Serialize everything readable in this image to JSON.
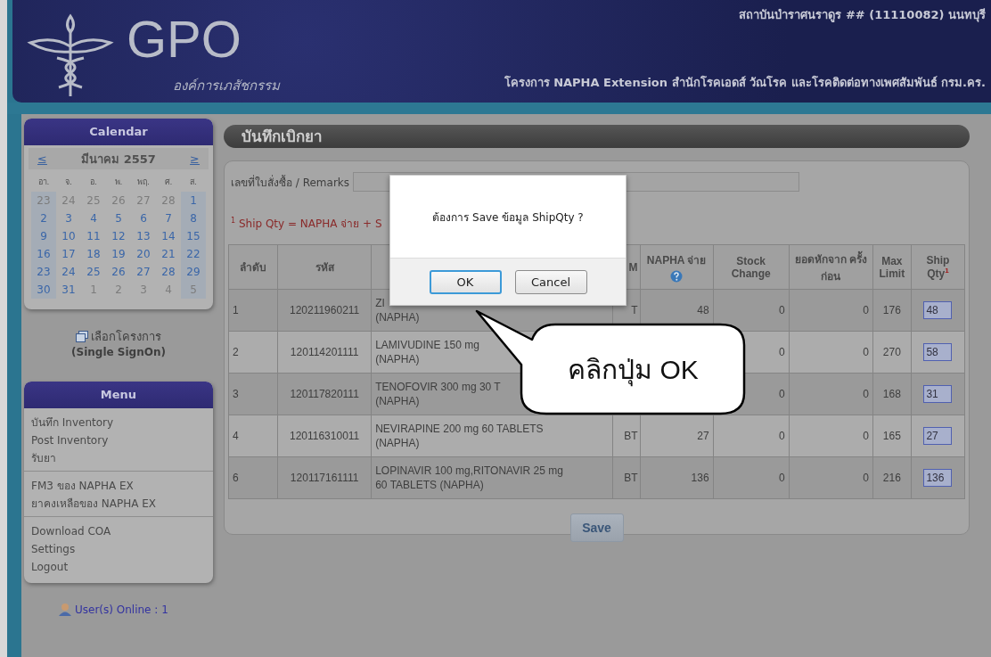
{
  "header": {
    "logo_text": "GPO",
    "logo_subtitle": "องค์การเภสัชกรรม",
    "institution": "สถาบันบำราศนราดูร ## (11110082) นนทบุรี",
    "project": "โครงการ NAPHA Extension สำนักโรคเอดส์ วัณโรค และโรคติดต่อทางเพศสัมพันธ์ กรม.คร."
  },
  "calendar": {
    "title": "Calendar",
    "prev": "≤",
    "month": "มีนาคม 2557",
    "next": "≥",
    "weekdays": [
      "อา.",
      "จ.",
      "อ.",
      "พ.",
      "พฤ.",
      "ศ.",
      "ส."
    ],
    "weeks": [
      [
        {
          "day": "23",
          "outside": true
        },
        {
          "day": "24",
          "outside": true
        },
        {
          "day": "25",
          "outside": true
        },
        {
          "day": "26",
          "outside": true
        },
        {
          "day": "27",
          "outside": true
        },
        {
          "day": "28",
          "outside": true
        },
        {
          "day": "1",
          "outside": false
        }
      ],
      [
        {
          "day": "2",
          "outside": false
        },
        {
          "day": "3",
          "outside": false
        },
        {
          "day": "4",
          "outside": false
        },
        {
          "day": "5",
          "outside": false
        },
        {
          "day": "6",
          "outside": false
        },
        {
          "day": "7",
          "outside": false
        },
        {
          "day": "8",
          "outside": false
        }
      ],
      [
        {
          "day": "9",
          "outside": false
        },
        {
          "day": "10",
          "outside": false
        },
        {
          "day": "11",
          "outside": false
        },
        {
          "day": "12",
          "outside": false
        },
        {
          "day": "13",
          "outside": false
        },
        {
          "day": "14",
          "outside": false
        },
        {
          "day": "15",
          "outside": false
        }
      ],
      [
        {
          "day": "16",
          "outside": false
        },
        {
          "day": "17",
          "outside": false
        },
        {
          "day": "18",
          "outside": false
        },
        {
          "day": "19",
          "outside": false
        },
        {
          "day": "20",
          "outside": false
        },
        {
          "day": "21",
          "outside": false
        },
        {
          "day": "22",
          "outside": false
        }
      ],
      [
        {
          "day": "23",
          "outside": false
        },
        {
          "day": "24",
          "outside": false
        },
        {
          "day": "25",
          "outside": false
        },
        {
          "day": "26",
          "outside": false
        },
        {
          "day": "27",
          "outside": false
        },
        {
          "day": "28",
          "outside": false
        },
        {
          "day": "29",
          "outside": false
        }
      ],
      [
        {
          "day": "30",
          "outside": false
        },
        {
          "day": "31",
          "outside": false
        },
        {
          "day": "1",
          "outside": true
        },
        {
          "day": "2",
          "outside": true
        },
        {
          "day": "3",
          "outside": true
        },
        {
          "day": "4",
          "outside": true
        },
        {
          "day": "5",
          "outside": true
        }
      ]
    ]
  },
  "project_select": {
    "label": "เลือกโครงการ",
    "sublabel": "(Single SignOn)"
  },
  "menu": {
    "title": "Menu",
    "groups": [
      [
        "บันทึก Inventory",
        "Post Inventory",
        "รับยา"
      ],
      [
        "FM3 ของ NAPHA EX",
        "ยาคงเหลือของ NAPHA EX"
      ],
      [
        "Download COA",
        "Settings",
        "Logout"
      ]
    ]
  },
  "users_online": "User(s) Online : 1",
  "main": {
    "title": "บันทึกเบิกยา",
    "remarks_label": "เลขที่ใบสั่งซื้อ / Remarks",
    "note": "$^{1}$ Ship Qty = NAPHA จ่าย + S",
    "columns": [
      "ลำดับ",
      "รหัส",
      null,
      "M",
      "NAPHA จ่าย",
      "Stock Change",
      "ยอดหักจาก ครั้งก่อน",
      "Max Limit",
      "Ship Qty$^{1}$"
    ],
    "rows": [
      {
        "no": "1",
        "code": "120211960211",
        "name_lines": [
          "ZI",
          "(NAPHA)"
        ],
        "unit": "T",
        "napha": "48",
        "stock_change": "0",
        "deduct": "0",
        "max_limit": "176",
        "ship_qty": "48"
      },
      {
        "no": "2",
        "code": "120114201111",
        "name_lines": [
          "LAMIVUDINE 150 mg",
          "(NAPHA)"
        ],
        "stock_change": "0",
        "deduct": "0",
        "max_limit": "270",
        "ship_qty": "58"
      },
      {
        "no": "3",
        "code": "120117820111",
        "name_lines": [
          "TENOFOVIR 300 mg 30 T",
          "(NAPHA)"
        ],
        "stock_change": "0",
        "deduct": "0",
        "max_limit": "168",
        "ship_qty": "31"
      },
      {
        "no": "4",
        "code": "120116310011",
        "name_lines": [
          "NEVIRAPINE 200 mg 60 TABLETS",
          "(NAPHA)"
        ],
        "unit": "BT",
        "napha": "27",
        "stock_change": "0",
        "deduct": "0",
        "max_limit": "165",
        "ship_qty": "27"
      },
      {
        "no": "6",
        "code": "120117161111",
        "name_lines": [
          "LOPINAVIR 100 mg,RITONAVIR 25 mg",
          "60 TABLETS (NAPHA)"
        ],
        "unit": "BT",
        "napha": "136",
        "stock_change": "0",
        "deduct": "0",
        "max_limit": "216",
        "ship_qty": "136"
      }
    ],
    "save_button": "Save"
  },
  "dialog": {
    "message": "ต้องการ Save ข้อมูล ShipQty ?",
    "buttons": [
      {
        "label": "OK",
        "focused": true
      },
      {
        "label": "Cancel",
        "focused": false
      }
    ]
  },
  "callout": {
    "text": "คลิกปุ่ม OK"
  }
}
